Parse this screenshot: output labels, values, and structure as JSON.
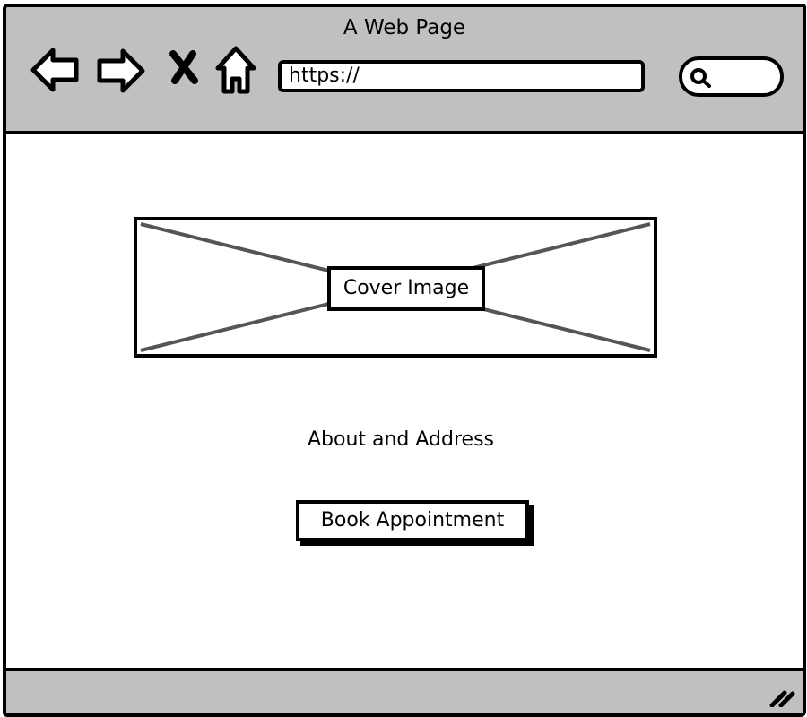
{
  "window": {
    "title": "A Web Page"
  },
  "toolbar": {
    "back_icon": "back-arrow-icon",
    "forward_icon": "forward-arrow-icon",
    "stop_icon": "close-icon",
    "home_icon": "home-icon",
    "address_value": "https://",
    "search_icon": "search-icon"
  },
  "main": {
    "cover_image_label": "Cover Image",
    "about_text": "About and Address",
    "book_button_label": "Book Appointment"
  },
  "statusbar": {
    "resize_icon": "resize-grip-icon"
  },
  "colors": {
    "chrome": "#c0c0c0",
    "stroke": "#000000",
    "placeholder_cross": "#555555",
    "background": "#ffffff"
  }
}
